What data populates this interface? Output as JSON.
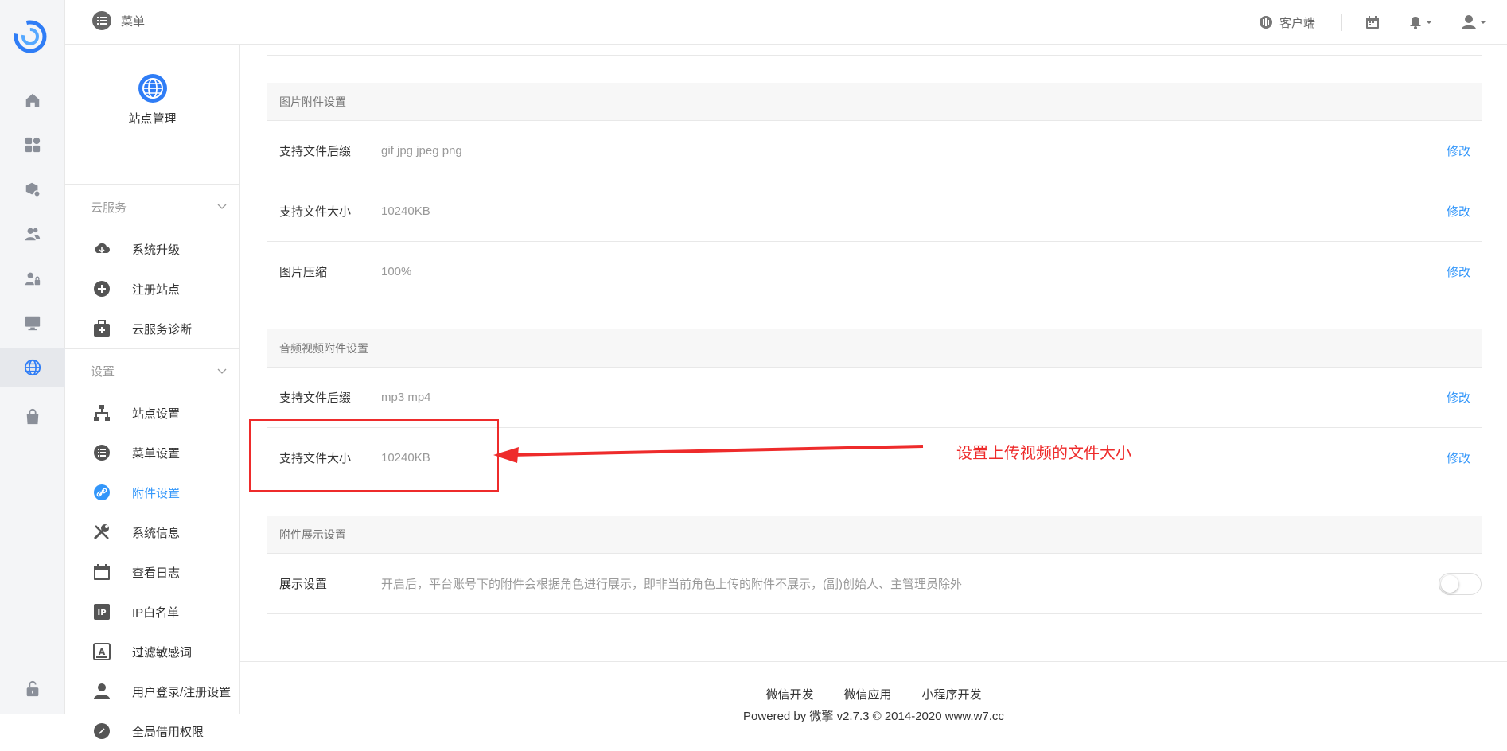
{
  "topbar": {
    "menu_label": "菜单",
    "client_label": "客户端"
  },
  "site_header": {
    "title": "站点管理"
  },
  "groups": {
    "cloud": {
      "title": "云服务",
      "items": [
        "系统升级",
        "注册站点",
        "云服务诊断"
      ]
    },
    "settings": {
      "title": "设置",
      "items": [
        "站点设置",
        "菜单设置",
        "附件设置",
        "系统信息",
        "查看日志",
        "IP白名单",
        "过滤敏感词",
        "用户登录/注册设置",
        "全局借用权限"
      ]
    }
  },
  "sections": {
    "image": {
      "title": "图片附件设置",
      "rows": [
        {
          "label": "支持文件后缀",
          "value": "gif jpg jpeg png",
          "action": "修改"
        },
        {
          "label": "支持文件大小",
          "value": "10240KB",
          "action": "修改"
        },
        {
          "label": "图片压缩",
          "value": "100%",
          "action": "修改"
        }
      ]
    },
    "media": {
      "title": "音频视频附件设置",
      "rows": [
        {
          "label": "支持文件后缀",
          "value": "mp3 mp4",
          "action": "修改"
        },
        {
          "label": "支持文件大小",
          "value": "10240KB",
          "action": "修改"
        }
      ]
    },
    "display": {
      "title": "附件展示设置",
      "rows": [
        {
          "label": "展示设置",
          "value": "开启后，平台账号下的附件会根据角色进行展示，即非当前角色上传的附件不展示，(副)创始人、主管理员除外",
          "toggle_on": false
        }
      ]
    }
  },
  "footer": {
    "links": [
      "微信开发",
      "微信应用",
      "小程序开发"
    ],
    "copyright": "Powered by 微擎 v2.7.3 © 2014-2020 www.w7.cc"
  },
  "annotation": {
    "text": "设置上传视频的文件大小"
  },
  "colors": {
    "accent": "#3296fa",
    "annotation": "#ee2b2b"
  }
}
